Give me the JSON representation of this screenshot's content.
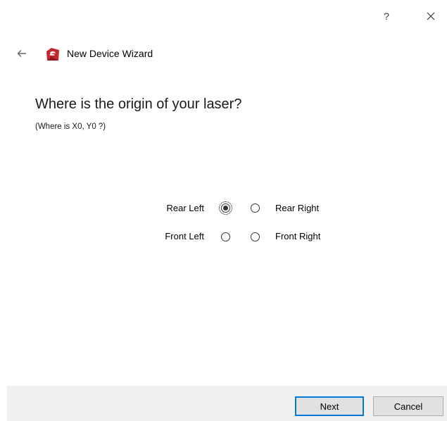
{
  "titlebar": {
    "help_label": "?",
    "close_icon": "close-icon"
  },
  "header": {
    "back_icon": "back-arrow-icon",
    "logo_icon": "app-logo-icon",
    "title": "New Device Wizard"
  },
  "page": {
    "question": "Where is the origin of your laser?",
    "subquestion": "(Where is X0, Y0 ?)"
  },
  "origin_options": [
    {
      "label": "Rear Left",
      "selected": true
    },
    {
      "label": "Rear Right",
      "selected": false
    },
    {
      "label": "Front Left",
      "selected": false
    },
    {
      "label": "Front Right",
      "selected": false
    }
  ],
  "footer": {
    "next_label": "Next",
    "cancel_label": "Cancel"
  },
  "colors": {
    "accent": "#0078d7",
    "logo": "#c4262e",
    "footer_bg": "#f0f0f0"
  }
}
